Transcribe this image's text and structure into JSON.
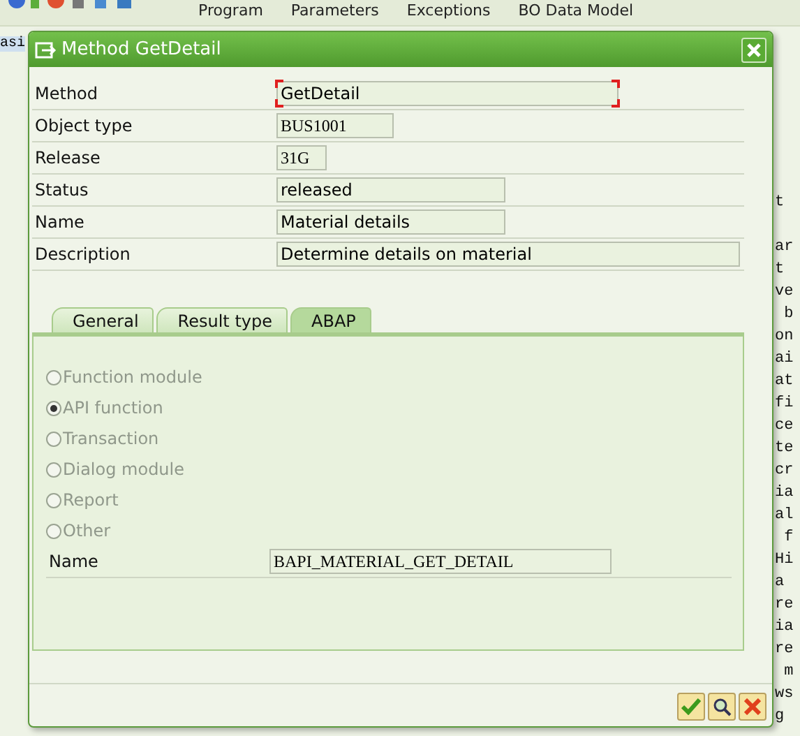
{
  "menu": [
    "Program",
    "Parameters",
    "Exceptions",
    "BO Data Model"
  ],
  "background_text": {
    "left": "asi",
    "right": [
      "t",
      "ar",
      "t",
      "ve",
      " b",
      "on",
      "ai",
      "at",
      "fi",
      "ce",
      "te",
      "cr",
      "ia",
      "al",
      " f",
      "Hi",
      "a",
      "re",
      "ia",
      "re",
      " m",
      "ws",
      "g"
    ]
  },
  "dialog": {
    "title": "Method GetDetail",
    "fields": [
      {
        "label": "Method",
        "value": "GetDetail",
        "focused": true
      },
      {
        "label": "Object type",
        "value": "BUS1001",
        "focused": false
      },
      {
        "label": "Release",
        "value": "31G",
        "focused": false
      },
      {
        "label": "Status",
        "value": "released",
        "focused": false
      },
      {
        "label": "Name",
        "value": "Material details",
        "focused": false
      },
      {
        "label": "Description",
        "value": "Determine details on material",
        "focused": false
      }
    ],
    "tabs": [
      {
        "label": "General",
        "selected": false
      },
      {
        "label": "Result type",
        "selected": false
      },
      {
        "label": "ABAP",
        "selected": true
      }
    ],
    "options": [
      {
        "label": "Function module",
        "selected": false,
        "disabled": true
      },
      {
        "label": "API function",
        "selected": true,
        "disabled": true
      },
      {
        "label": "Transaction",
        "selected": false,
        "disabled": true
      },
      {
        "label": "Dialog module",
        "selected": false,
        "disabled": true
      },
      {
        "label": "Report",
        "selected": false,
        "disabled": true
      },
      {
        "label": "Other",
        "selected": false,
        "disabled": true
      }
    ],
    "abap_name": {
      "label": "Name",
      "value": "BAPI_MATERIAL_GET_DETAIL"
    }
  }
}
